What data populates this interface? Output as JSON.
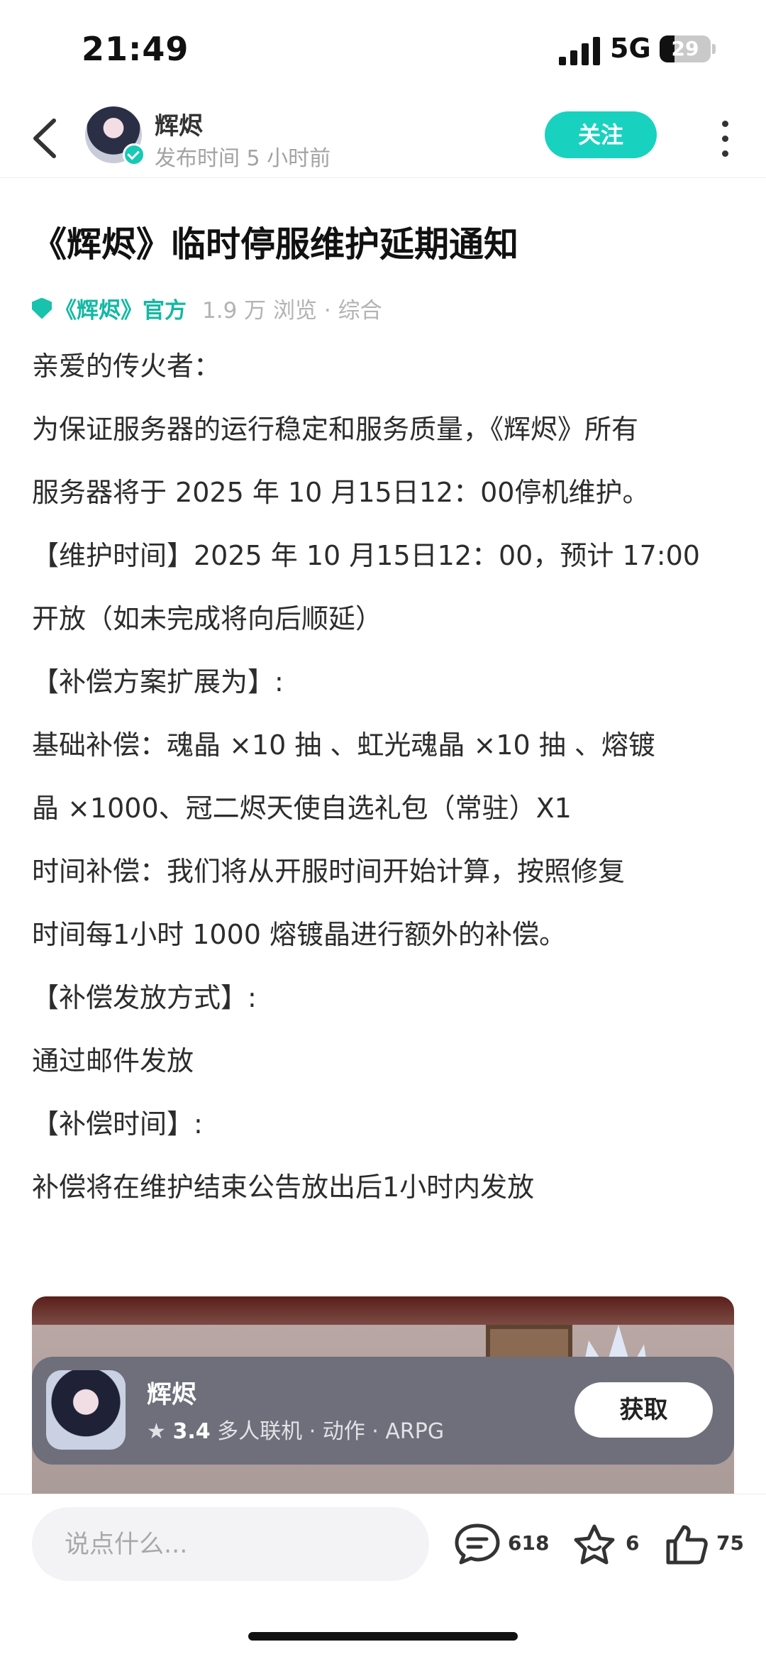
{
  "status_bar": {
    "time": "21:49",
    "network": "5G",
    "battery": "29",
    "battery_level": 0.29
  },
  "header": {
    "author": "辉烬",
    "posted_time": "发布时间 5 小时前",
    "follow_label": "关注"
  },
  "article": {
    "title": "《辉烬》临时停服维护延期通知",
    "official_label": "《辉烬》官方",
    "views": "1.9 万 浏览 · 综合",
    "paragraphs": [
      "亲爱的传火者：",
      "为保证服务器的运行稳定和服务质量，《辉烬》所有",
      "服务器将于 2025 年 10 月15日12：00停机维护。",
      "【维护时间】2025 年 10 月15日12：00，预计 17:00",
      "开放（如未完成将向后顺延）",
      "【补偿方案扩展为】:",
      "基础补偿：魂晶 ×10 抽 、虹光魂晶 ×10 抽 、熔镀",
      "晶 ×1000、冠二烬天使自选礼包（常驻）X1",
      "时间补偿：我们将从开服时间开始计算，按照修复",
      "时间每1小时 1000 熔镀晶进行额外的补偿。",
      "【补偿发放方式】:",
      "通过邮件发放",
      "【补偿时间】:",
      "补偿将在维护结束公告放出后1小时内发放"
    ]
  },
  "app_card": {
    "name": "辉烬",
    "rating": "3.4",
    "tags": "多人联机 · 动作 · ARPG",
    "get_label": "获取"
  },
  "bottom_bar": {
    "comment_placeholder": "说点什么...",
    "comments_count": "618",
    "favorites_count": "6",
    "likes_count": "75"
  },
  "colors": {
    "accent": "#18d2bf",
    "official": "#14b8a3"
  }
}
